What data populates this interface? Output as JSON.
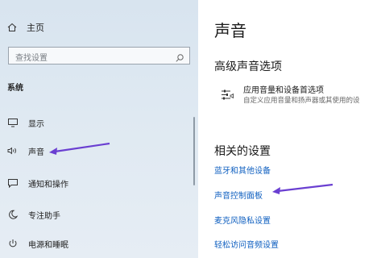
{
  "sidebar": {
    "home_label": "主页",
    "search_placeholder": "查找设置",
    "section_label": "系统",
    "items": [
      {
        "label": "显示",
        "icon": "monitor-icon"
      },
      {
        "label": "声音",
        "icon": "speaker-icon"
      },
      {
        "label": "通知和操作",
        "icon": "notification-icon"
      },
      {
        "label": "专注助手",
        "icon": "moon-icon"
      },
      {
        "label": "电源和睡眠",
        "icon": "power-icon"
      }
    ]
  },
  "main": {
    "title": "声音",
    "advanced_heading": "高级声音选项",
    "advanced_item": {
      "title": "应用音量和设备首选项",
      "description": "自定义应用音量和扬声器或其使用的设",
      "icon": "mixer-icon"
    },
    "related_heading": "相关的设置",
    "related_links": [
      "蓝牙和其他设备",
      "声音控制面板",
      "麦克风隐私设置",
      "轻松访问音频设置"
    ]
  },
  "colors": {
    "link": "#1060c0",
    "arrow": "#6a3fd1",
    "sidebar_bg": "#dce6f0"
  }
}
